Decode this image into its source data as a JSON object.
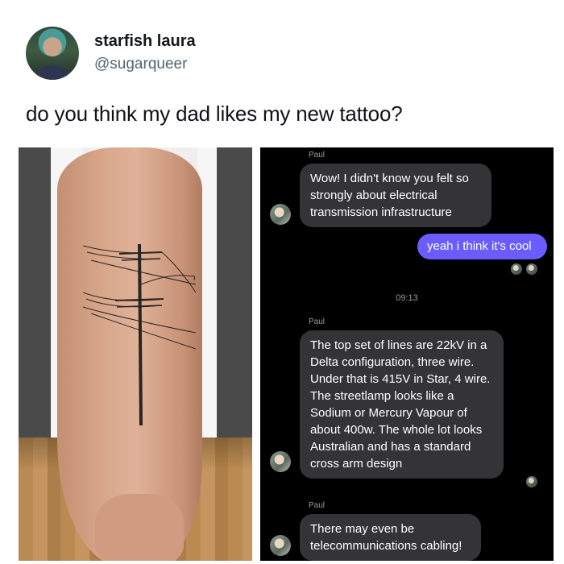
{
  "tweet": {
    "display_name": "starfish laura",
    "handle": "@sugarqueer",
    "text": "do you think my dad likes my new tattoo?"
  },
  "chat": {
    "sender_name": "Paul",
    "messages": [
      {
        "from": "Paul",
        "text": "Wow! I didn't know you felt so strongly about electrical transmission infrastructure"
      },
      {
        "from": "me",
        "text": "yeah i think it's cool"
      },
      {
        "from": "Paul",
        "text": "The top set of lines are 22kV in a Delta configuration, three wire. Under that is 415V in Star, 4 wire. The streetlamp looks like a Sodium or Mercury Vapour of about 400w. The whole lot looks Australian and has a standard cross arm design"
      },
      {
        "from": "Paul",
        "text": "There may even be telecommunications cabling!"
      }
    ],
    "timestamp": "09:13"
  },
  "colors": {
    "outgoing_bubble": "#6b5cff",
    "incoming_bubble": "#343437",
    "chat_background": "#000000"
  }
}
